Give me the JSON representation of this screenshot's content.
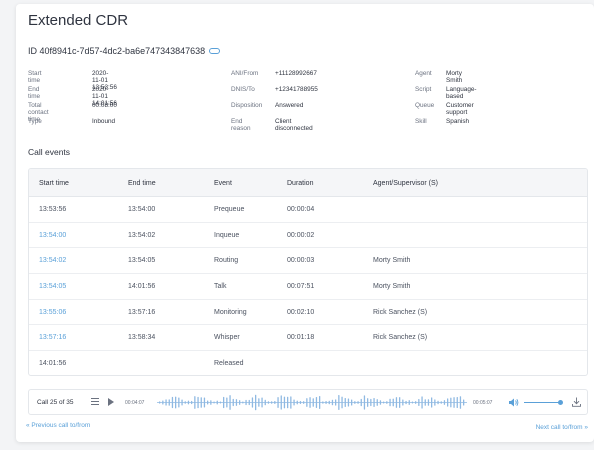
{
  "header": {
    "title": "Extended CDR",
    "id_text": "ID 40f8941c-7d57-4dc2-ba6e747343847638"
  },
  "info": {
    "col1": [
      {
        "label": "Start time",
        "value": "2020-11-01 13:53:56"
      },
      {
        "label": "End time",
        "value": "2020-11-01 14:01:56"
      },
      {
        "label": "Total contact time",
        "value": "00:08:00"
      },
      {
        "label": "Type",
        "value": "Inbound"
      }
    ],
    "col2": [
      {
        "label": "ANI/From",
        "value": "+11128992667"
      },
      {
        "label": "DNIS/To",
        "value": "+12341788955"
      },
      {
        "label": "Disposition",
        "value": "Answered"
      },
      {
        "label": "End reason",
        "value": "Client disconnected"
      }
    ],
    "col3": [
      {
        "label": "Agent",
        "value": "Morty Smith"
      },
      {
        "label": "Script",
        "value": "Language-based"
      },
      {
        "label": "Queue",
        "value": "Customer support"
      },
      {
        "label": "Skill",
        "value": "Spanish"
      }
    ]
  },
  "events": {
    "title": "Call events",
    "headers": [
      "Start time",
      "End time",
      "Event",
      "Duration",
      "Agent/Supervisor (S)"
    ],
    "rows": [
      {
        "start": "13:53:56",
        "end": "13:54:00",
        "event": "Prequeue",
        "duration": "00:00:04",
        "agent": "",
        "link": false
      },
      {
        "start": "13:54:00",
        "end": "13:54:02",
        "event": "Inqueue",
        "duration": "00:00:02",
        "agent": "",
        "link": true
      },
      {
        "start": "13:54:02",
        "end": "13:54:05",
        "event": "Routing",
        "duration": "00:00:03",
        "agent": "Morty Smith",
        "link": true
      },
      {
        "start": "13:54:05",
        "end": "14:01:56",
        "event": "Talk",
        "duration": "00:07:51",
        "agent": "Morty Smith",
        "link": true
      },
      {
        "start": "13:55:06",
        "end": "13:57:16",
        "event": "Monitoring",
        "duration": "00:02:10",
        "agent": "Rick Sanchez (S)",
        "link": true
      },
      {
        "start": "13:57:16",
        "end": "13:58:34",
        "event": "Whisper",
        "duration": "00:01:18",
        "agent": "Rick Sanchez (S)",
        "link": true
      },
      {
        "start": "14:01:56",
        "end": "",
        "event": "Released",
        "duration": "",
        "agent": "",
        "link": false
      }
    ]
  },
  "player": {
    "call_count": "Call 25 of 35",
    "time_start": "00:04:07",
    "time_end": "00:05:07",
    "volume": 0.9,
    "icons": [
      "list-icon",
      "play-icon",
      "volume-icon",
      "download-icon"
    ]
  },
  "nav": {
    "prev": "« Previous call to/from",
    "next": "Next call to/from »"
  },
  "colors": {
    "accent": "#5aa0d8",
    "text": "#2f3440",
    "muted": "#6b7280"
  }
}
